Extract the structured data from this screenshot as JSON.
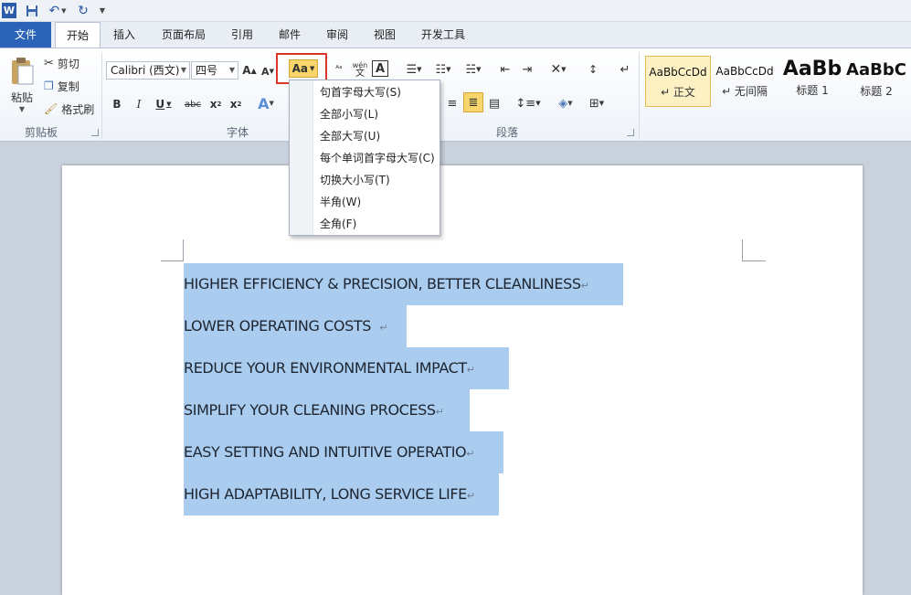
{
  "qat": {
    "app_icon": "W"
  },
  "tabs": [
    "文件",
    "开始",
    "插入",
    "页面布局",
    "引用",
    "邮件",
    "审阅",
    "视图",
    "开发工具"
  ],
  "clipboard": {
    "paste": "粘贴",
    "cut": "剪切",
    "copy": "复制",
    "format_painter": "格式刷",
    "group": "剪贴板"
  },
  "font": {
    "name": "Calibri (西文)",
    "size": "四号",
    "group": "字体",
    "case_button": "Aa"
  },
  "paragraph": {
    "group": "段落"
  },
  "styles": [
    {
      "sample": "AaBbCcDd",
      "name": "↵ 正文"
    },
    {
      "sample": "AaBbCcDd",
      "name": "↵ 无间隔"
    },
    {
      "sample": "AaBb",
      "name": "标题 1"
    },
    {
      "sample": "AaBbC",
      "name": "标题 2"
    }
  ],
  "case_menu": [
    "句首字母大写(S)",
    "全部小写(L)",
    "全部大写(U)",
    "每个单词首字母大写(C)",
    "切换大小写(T)",
    "半角(W)",
    "全角(F)"
  ],
  "document": {
    "lines": [
      "HIGHER EFFICIENCY & PRECISION, BETTER CLEANLINESS",
      "LOWER OPERATING COSTS  ",
      "REDUCE YOUR ENVIRONMENTAL IMPACT",
      "SIMPLIFY YOUR CLEANING PROCESS",
      "EASY SETTING AND INTUITIVE OPERATIO",
      "HIGH ADAPTABILITY, LONG SERVICE LIFE"
    ],
    "paragraph_mark": "↵"
  },
  "colors": {
    "file_tab": "#2a63b8",
    "selection": "#a9ccef",
    "highlight_box": "#d9352b",
    "active_button": "#f8d66b"
  }
}
